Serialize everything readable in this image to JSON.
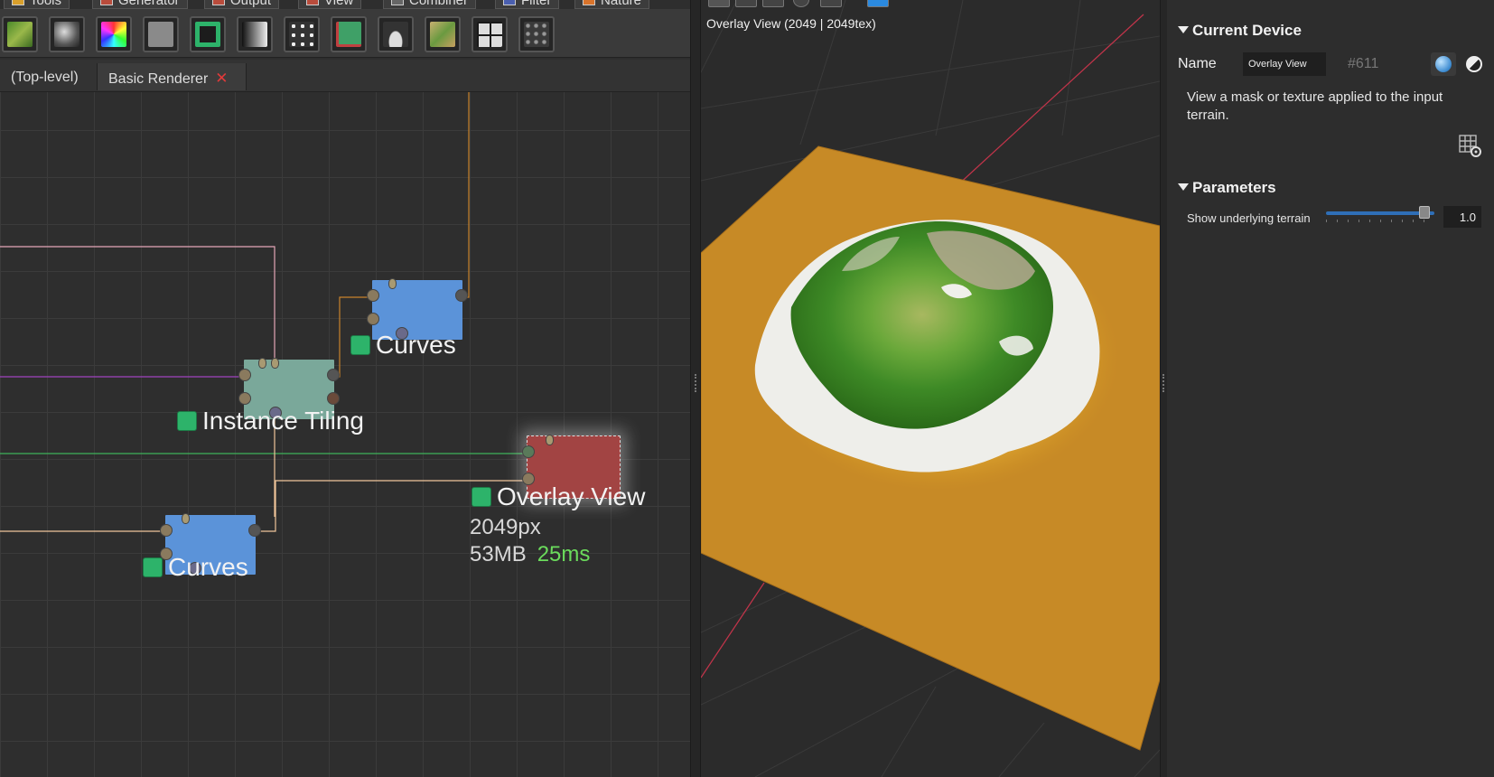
{
  "menu_tabs": [
    {
      "label": "Tools"
    },
    {
      "label": "Generator"
    },
    {
      "label": "Output"
    },
    {
      "label": "View"
    },
    {
      "label": "Combiner"
    },
    {
      "label": "Filter"
    },
    {
      "label": "Nature"
    }
  ],
  "breadcrumbs": {
    "top_level": "(Top-level)",
    "current": "Basic Renderer",
    "close_glyph": "✕"
  },
  "nodes": {
    "curves_top": {
      "label": "Curves",
      "color": "#5b93d9"
    },
    "instance_tiling": {
      "label": "Instance Tiling",
      "color": "#7aa89a"
    },
    "overlay_view": {
      "label": "Overlay View",
      "color": "#a24443",
      "resolution": "2049px",
      "memory": "53MB",
      "time": "25ms"
    },
    "curves_bottom": {
      "label": "Curves",
      "color": "#5b93d9"
    }
  },
  "viewport": {
    "title": "Overlay View (2049 | 2049tex)"
  },
  "properties": {
    "current_device_header": "Current Device",
    "name_label": "Name",
    "name_value": "Overlay View",
    "device_id": "#611",
    "description": "View a mask or texture applied to the input terrain.",
    "parameters_header": "Parameters",
    "params": [
      {
        "label": "Show underlying terrain",
        "value": "1.0",
        "fraction": 0.95
      }
    ]
  },
  "colors": {
    "accent": "#2f6fb7",
    "status_green": "#6bdc5c",
    "node_status": "#2db36a",
    "close_red": "#e03a3a"
  }
}
